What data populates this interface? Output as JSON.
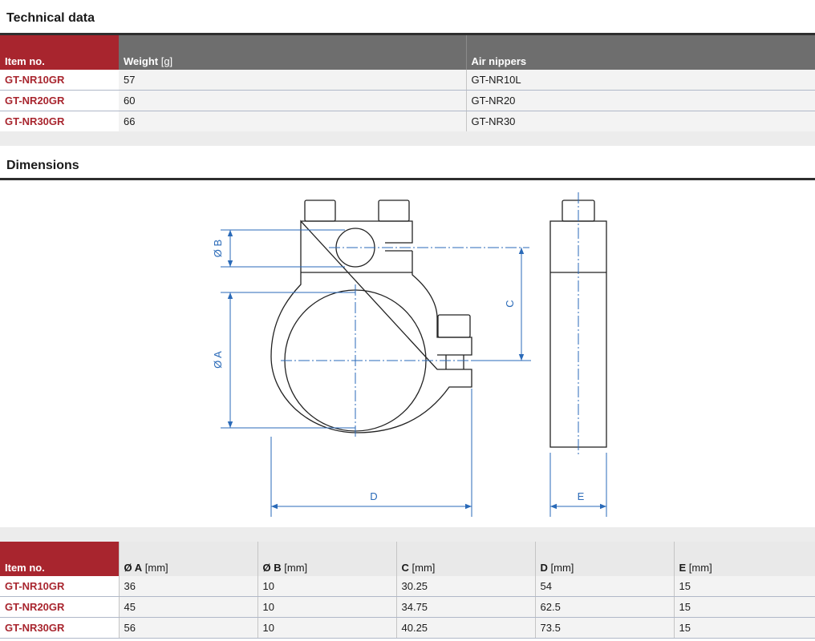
{
  "technical": {
    "title": "Technical data",
    "headers": {
      "item": "Item no.",
      "weight": "Weight",
      "weight_unit": "[g]",
      "nippers": "Air nippers"
    },
    "rows": [
      {
        "item": "GT-NR10GR",
        "weight": "57",
        "nippers": "GT-NR10L"
      },
      {
        "item": "GT-NR20GR",
        "weight": "60",
        "nippers": "GT-NR20"
      },
      {
        "item": "GT-NR30GR",
        "weight": "66",
        "nippers": "GT-NR30"
      }
    ]
  },
  "dimensions": {
    "title": "Dimensions",
    "labels": {
      "a": "Ø A",
      "b": "Ø B",
      "c": "C",
      "d": "D",
      "e": "E"
    },
    "headers": {
      "item": "Item no.",
      "a": "Ø A",
      "b": "Ø B",
      "c": "C",
      "d": "D",
      "e": "E",
      "unit": "[mm]"
    },
    "rows": [
      {
        "item": "GT-NR10GR",
        "a": "36",
        "b": "10",
        "c": "30.25",
        "d": "54",
        "e": "15"
      },
      {
        "item": "GT-NR20GR",
        "a": "45",
        "b": "10",
        "c": "34.75",
        "d": "62.5",
        "e": "15"
      },
      {
        "item": "GT-NR30GR",
        "a": "56",
        "b": "10",
        "c": "40.25",
        "d": "73.5",
        "e": "15"
      }
    ]
  },
  "colors": {
    "accent": "#a8252e",
    "dimension": "#2a6ab8",
    "header_gray": "#6e6e6e"
  }
}
